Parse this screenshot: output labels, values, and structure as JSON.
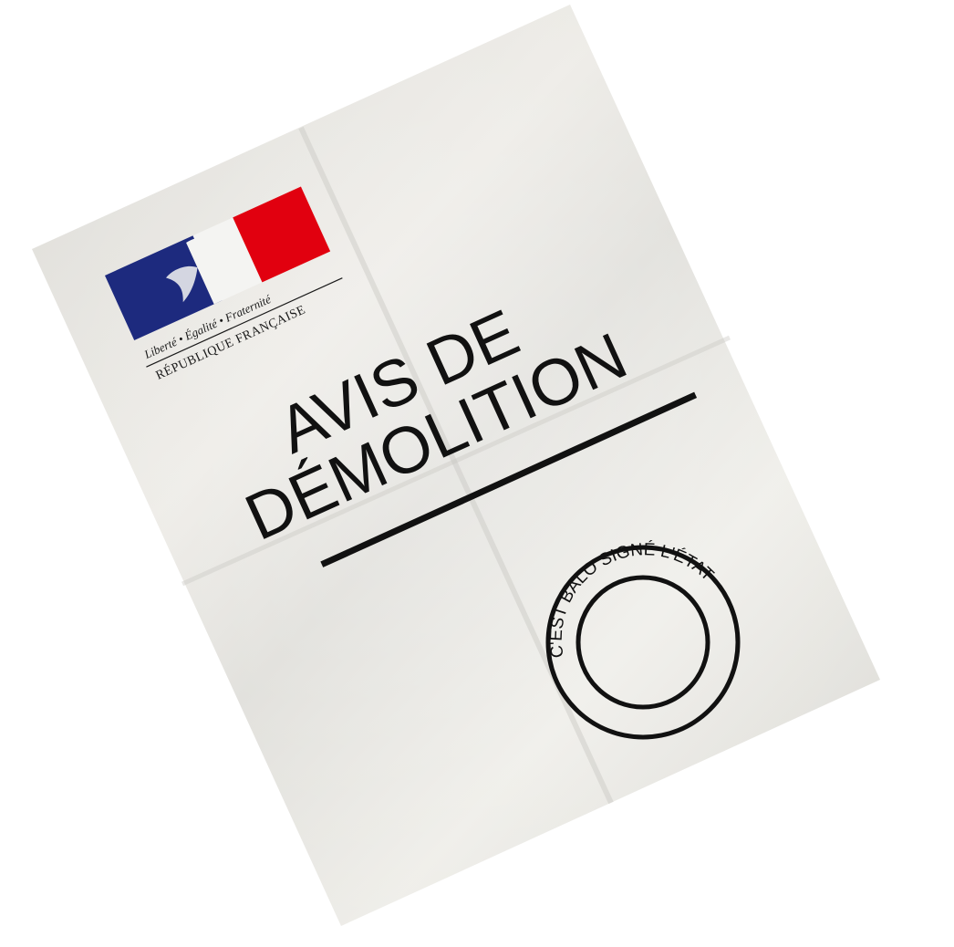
{
  "document": {
    "title_line1": "AVIS DE",
    "title_line2": "DÉMOLITION"
  },
  "marianne_logo": {
    "motto": "Liberté • Égalité • Fraternité",
    "republic": "RÉPUBLIQUE FRANÇAISE",
    "colors": {
      "blue": "#1d2a7e",
      "red": "#e1000f"
    }
  },
  "stamp": {
    "text": "C'EST BALO SIGNÉ L'ÉTAT"
  },
  "colors": {
    "paper": "#e7e6e1",
    "ink": "#111111"
  }
}
